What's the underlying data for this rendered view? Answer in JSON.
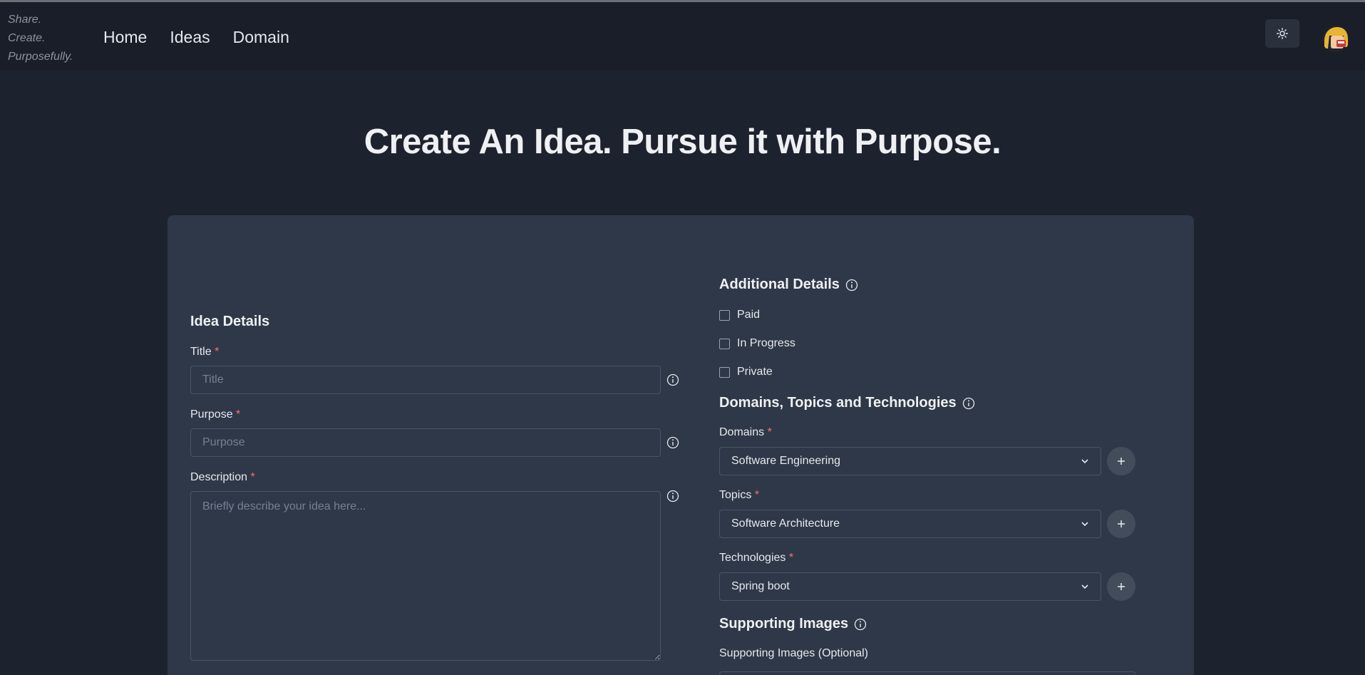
{
  "nav": {
    "tagline": [
      "Share.",
      "Create.",
      "Purposefully."
    ],
    "links": [
      "Home",
      "Ideas",
      "Domain"
    ]
  },
  "hero": {
    "title": "Create An Idea. Pursue it with Purpose."
  },
  "idea_details": {
    "heading": "Idea Details",
    "title_label": "Title",
    "title_placeholder": "Title",
    "purpose_label": "Purpose",
    "purpose_placeholder": "Purpose",
    "description_label": "Description",
    "description_placeholder": "Briefly describe your idea here...",
    "required_mark": "*"
  },
  "additional_details": {
    "heading": "Additional Details",
    "checkboxes": [
      "Paid",
      "In Progress",
      "Private"
    ]
  },
  "dtt": {
    "heading": "Domains, Topics and Technologies",
    "domains_label": "Domains",
    "domains_value": "Software Engineering",
    "topics_label": "Topics",
    "topics_value": "Software Architecture",
    "technologies_label": "Technologies",
    "technologies_value": "Spring boot"
  },
  "supporting_images": {
    "heading": "Supporting Images",
    "label": "Supporting Images (Optional)"
  },
  "colors": {
    "page_bg": "#1d232e",
    "navbar_bg": "#191e28",
    "card_bg": "#2f3848",
    "required": "#f87171"
  }
}
